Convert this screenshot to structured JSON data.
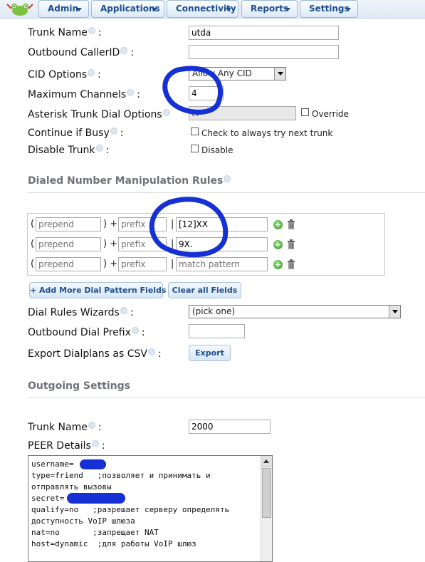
{
  "nav": {
    "items": [
      {
        "label": "Admin"
      },
      {
        "label": "Applications"
      },
      {
        "label": "Connectivity"
      },
      {
        "label": "Reports"
      },
      {
        "label": "Settings"
      }
    ]
  },
  "general": {
    "trunk_name": {
      "label": "Trunk Name",
      "value": "utda"
    },
    "outbound_callerid": {
      "label": "Outbound CallerID",
      "value": ""
    },
    "cid_options": {
      "label": "CID Options",
      "value": "Allow Any CID"
    },
    "max_channels": {
      "label": "Maximum Channels",
      "value": "4"
    },
    "dial_options": {
      "label": "Asterisk Trunk Dial Options",
      "value": "tT",
      "override_label": "Override"
    },
    "continue_busy": {
      "label": "Continue if Busy",
      "checkbox_label": "Check to always try next trunk"
    },
    "disable_trunk": {
      "label": "Disable Trunk",
      "checkbox_label": "Disable"
    }
  },
  "dial_rules": {
    "section_title": "Dialed Number Manipulation Rules",
    "rows": [
      {
        "prepend": "prepend",
        "prefix": "prefix",
        "pattern": "[12]XX"
      },
      {
        "prepend": "prepend",
        "prefix": "prefix",
        "pattern": "9X."
      },
      {
        "prepend": "prepend",
        "prefix": "prefix",
        "pattern": "match pattern"
      }
    ],
    "add_more_label": "+ Add More Dial Pattern Fields",
    "clear_all_label": "Clear all Fields",
    "wizards": {
      "label": "Dial Rules Wizards",
      "value": "(pick one)"
    },
    "outbound_prefix": {
      "label": "Outbound Dial Prefix",
      "value": ""
    },
    "export": {
      "label": "Export Dialplans as CSV",
      "button": "Export"
    }
  },
  "outgoing": {
    "section_title": "Outgoing Settings",
    "trunk_name": {
      "label": "Trunk Name",
      "value": "2000"
    },
    "peer_details": {
      "label": "PEER Details",
      "text": "username=\ntype=friend   ;позволяет и принимать и отправлять вызовы\nsecret=\nqualify=no   ;разрешает серверу определять доступность VoIP шлюза\nnat=no       ;запрещает NAT\nhost=dynamic  ;для работы VoIP шлюз"
    }
  },
  "colors": {
    "accent": "#1e4f8c",
    "annotation": "#1531d6"
  }
}
